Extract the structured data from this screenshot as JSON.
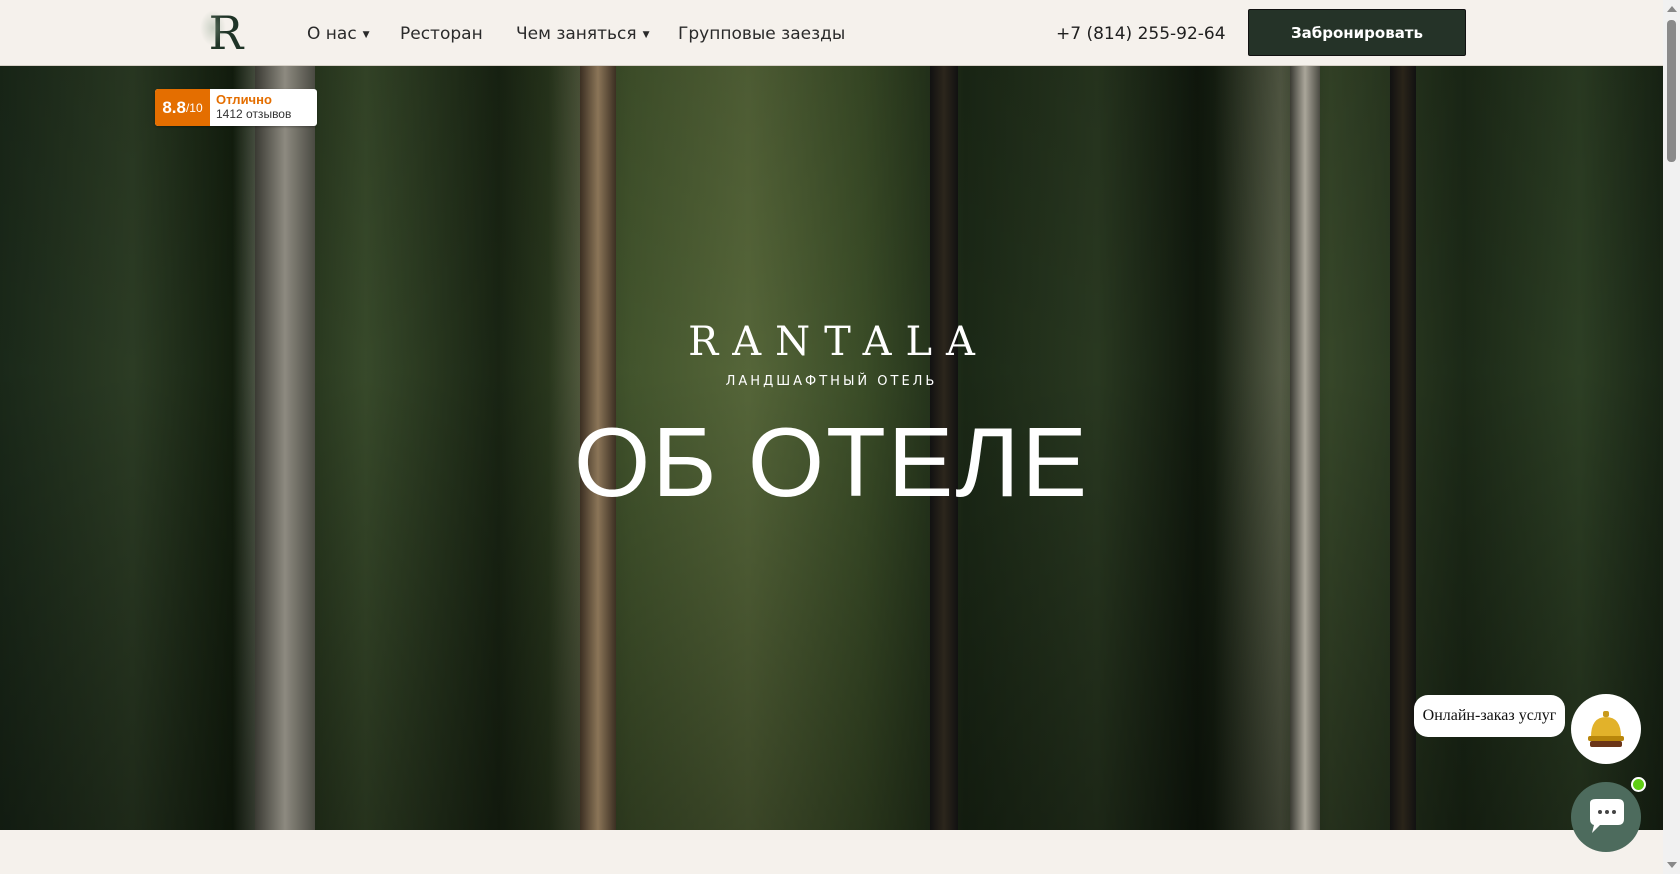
{
  "header": {
    "logo": "R",
    "nav": [
      {
        "label": "О нас",
        "dropdown": true
      },
      {
        "label": "Ресторан",
        "dropdown": false
      },
      {
        "label": "Чем заняться",
        "dropdown": true
      },
      {
        "label": "Групповые заезды",
        "dropdown": false
      }
    ],
    "phone": "+7 (814) 255-92-64",
    "book_label": "Забронировать"
  },
  "rating": {
    "score": "8.8",
    "scale": "/10",
    "label": "Отлично",
    "reviews": "1412 отзывов"
  },
  "hero": {
    "brand": "RANTALA",
    "subtitle": "ЛАНДШАФТНЫЙ ОТЕЛЬ",
    "title": "ОБ ОТЕЛЕ"
  },
  "widgets": {
    "services_label": "Онлайн-заказ услуг",
    "status_color": "#5fce14"
  },
  "colors": {
    "accent": "#253328",
    "rating": "#e46e00",
    "background": "#f5f1ec"
  }
}
